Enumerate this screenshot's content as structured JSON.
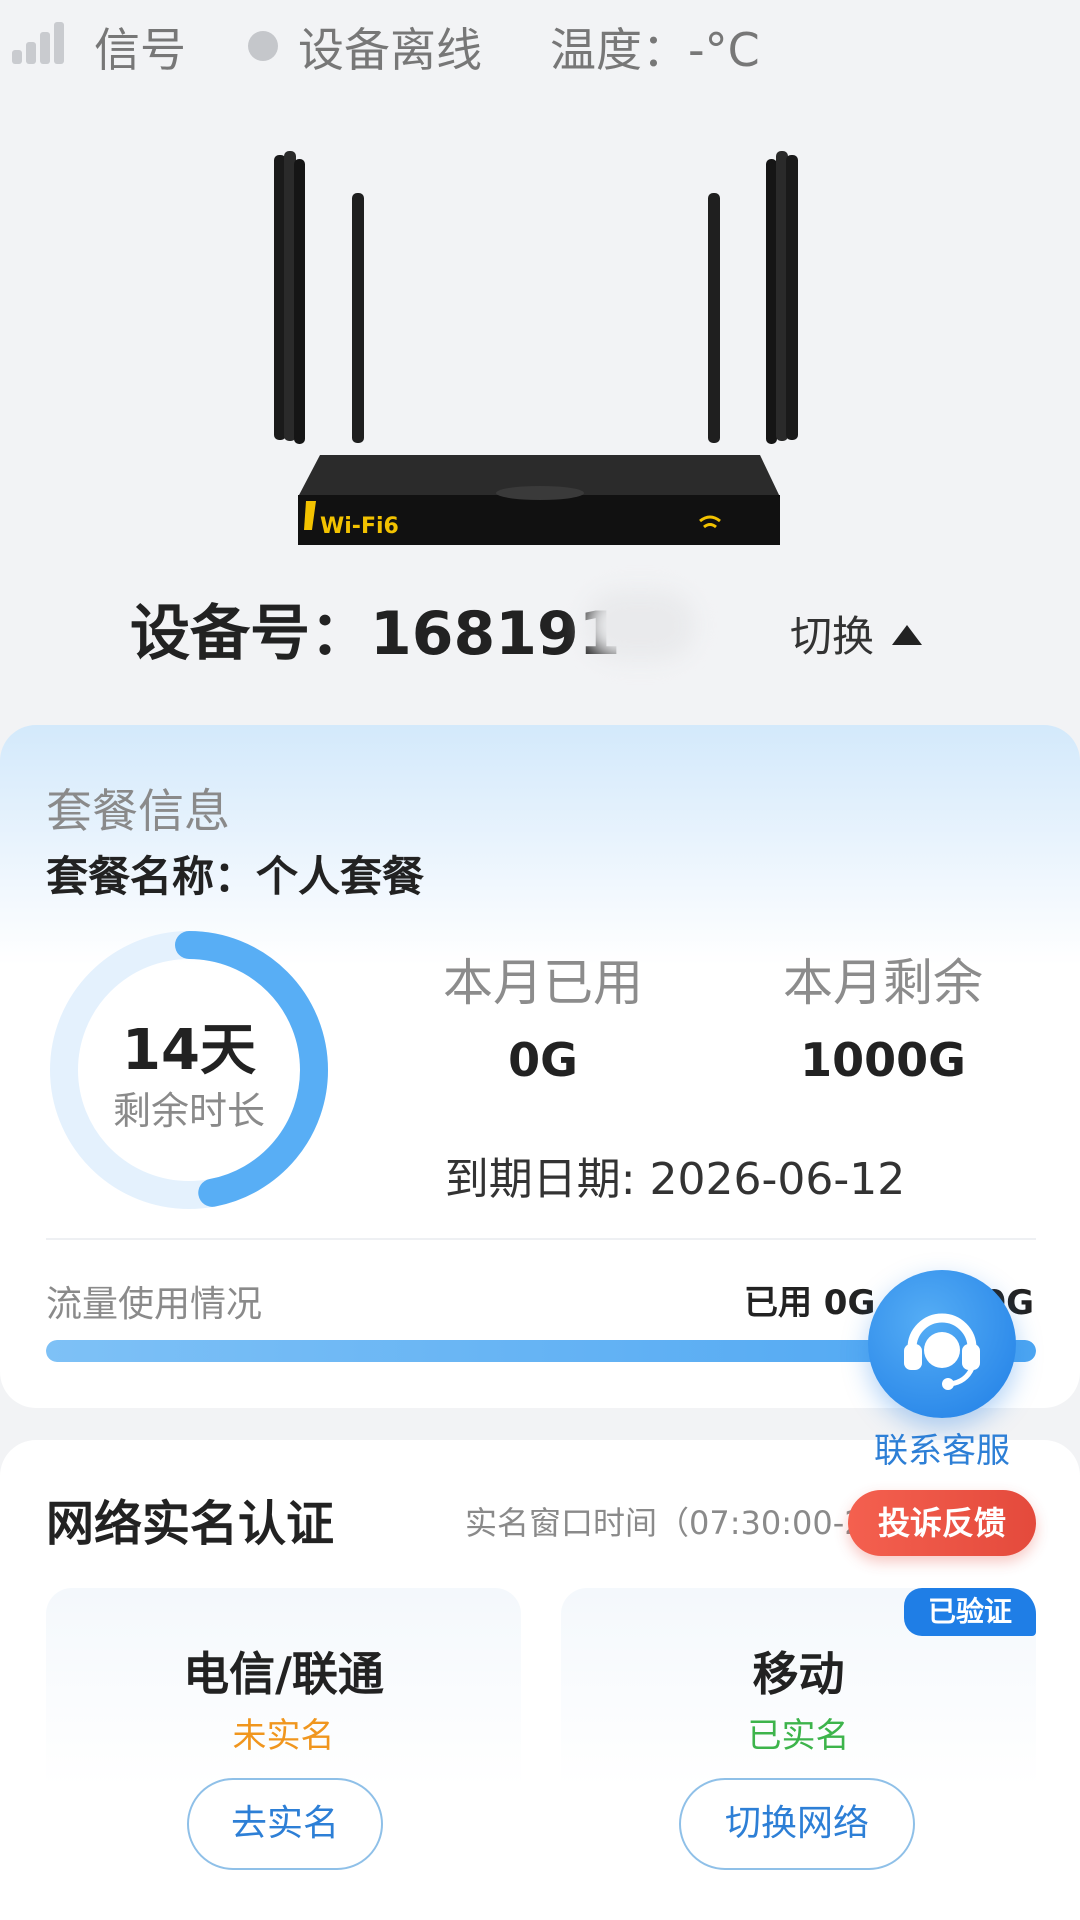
{
  "status_bar": {
    "signal_label": "信号",
    "device_state": "设备离线",
    "temperature": "温度：-°C"
  },
  "device": {
    "id_label": "设备号：",
    "id_value": "168191",
    "switch_label": "切换"
  },
  "plan": {
    "section_title": "套餐信息",
    "name_label": "套餐名称：",
    "name_value": "个人套餐",
    "remaining_days": "14天",
    "remaining_days_label": "剩余时长",
    "remaining_days_fraction": 0.47,
    "used_label": "本月已用",
    "used_value": "0G",
    "left_label": "本月剩余",
    "left_value": "1000G",
    "expire_text": "到期日期: 2026-06-12",
    "usage_title": "流量使用情况",
    "usage_value": "已用 0G / 1000G",
    "usage_fraction": 1.0
  },
  "support": {
    "label": "联系客服"
  },
  "realname": {
    "title": "网络实名认证",
    "window_time": "实名窗口时间（07:30:00-2",
    "complaint_button": "投诉反馈",
    "carriers": [
      {
        "name": "电信/联通",
        "status": "未实名",
        "status_color": "#f0961e",
        "button": "去实名"
      },
      {
        "name": "移动",
        "status": "已实名",
        "status_color": "#3db44b",
        "button": "切换网络",
        "tag": "已验证"
      }
    ]
  },
  "colors": {
    "accent": "#2d7fd6",
    "ring": "#58aef5",
    "danger": "#e44a3c"
  }
}
